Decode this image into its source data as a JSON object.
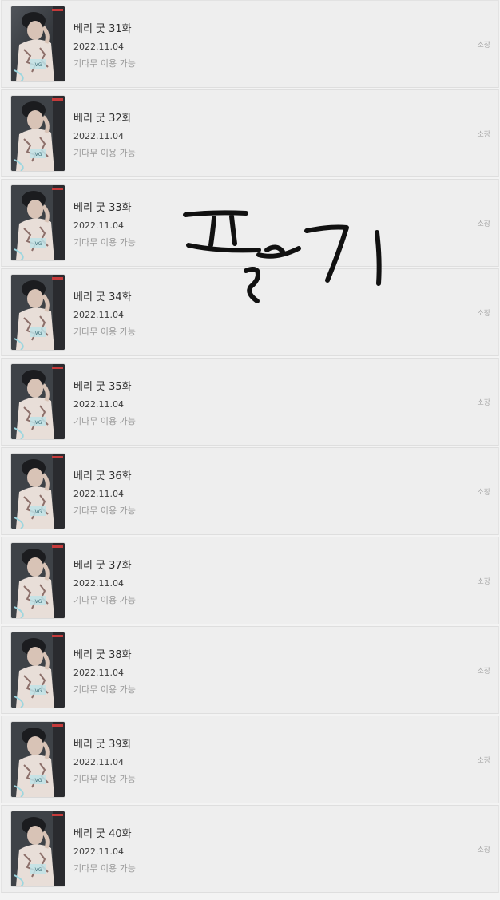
{
  "episodes": [
    {
      "title": "베리 굿 31화",
      "date": "2022.11.04",
      "status": "기다무 이용 가능",
      "owned": "소장"
    },
    {
      "title": "베리 굿 32화",
      "date": "2022.11.04",
      "status": "기다무 이용 가능",
      "owned": "소장"
    },
    {
      "title": "베리 굿 33화",
      "date": "2022.11.04",
      "status": "기다무 이용 가능",
      "owned": "소장"
    },
    {
      "title": "베리 굿 34화",
      "date": "2022.11.04",
      "status": "기다무 이용 가능",
      "owned": "소장"
    },
    {
      "title": "베리 굿 35화",
      "date": "2022.11.04",
      "status": "기다무 이용 가능",
      "owned": "소장"
    },
    {
      "title": "베리 굿 36화",
      "date": "2022.11.04",
      "status": "기다무 이용 가능",
      "owned": "소장"
    },
    {
      "title": "베리 굿 37화",
      "date": "2022.11.04",
      "status": "기다무 이용 가능",
      "owned": "소장"
    },
    {
      "title": "베리 굿 38화",
      "date": "2022.11.04",
      "status": "기다무 이용 가능",
      "owned": "소장"
    },
    {
      "title": "베리 굿 39화",
      "date": "2022.11.04",
      "status": "기다무 이용 가능",
      "owned": "소장"
    },
    {
      "title": "베리 굿 40화",
      "date": "2022.11.04",
      "status": "기다무 이용 가능",
      "owned": "소장"
    }
  ],
  "overlay": {
    "handwriting": "팔기"
  }
}
